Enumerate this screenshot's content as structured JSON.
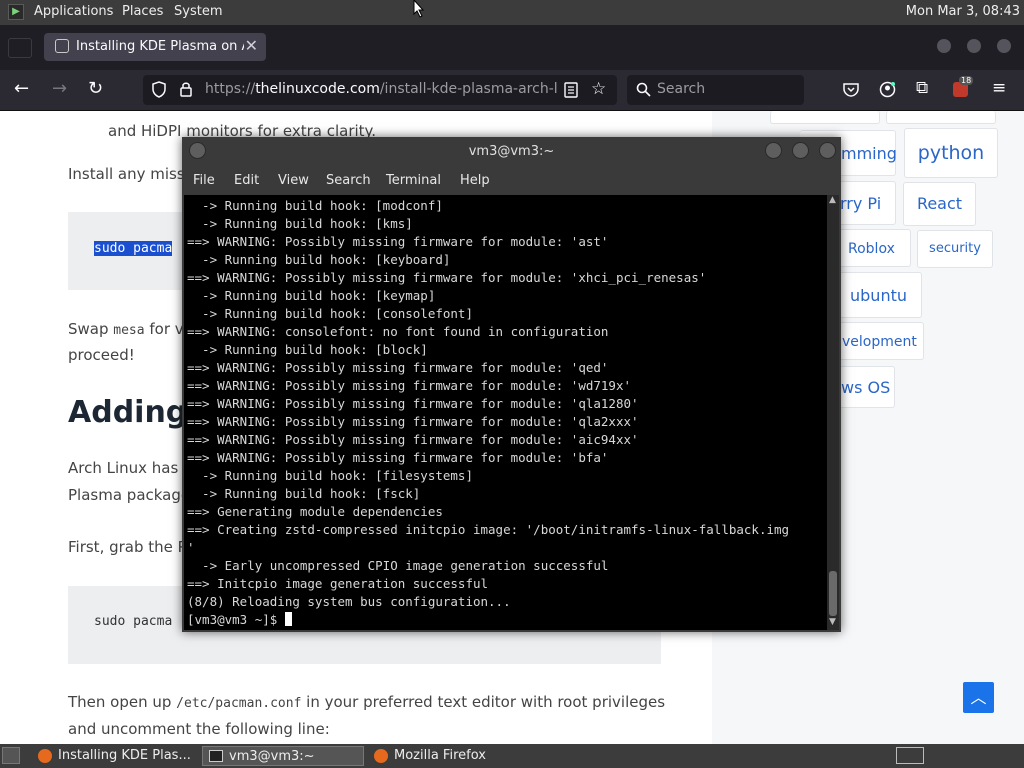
{
  "top_panel": {
    "menus": [
      "Applications",
      "Places",
      "System"
    ],
    "clock": "Mon Mar  3, 08:43"
  },
  "browser": {
    "tab_title": "Installing KDE Plasma on Arch",
    "tab_close": "✕",
    "url_scheme": "https://",
    "url_host": "thelinuxcode.com",
    "url_path": "/install-kde-plasma-arch-linux/",
    "search_placeholder": "Search",
    "addon_badge": "18"
  },
  "article": {
    "line_1": "and HiDPI monitors for extra clarity.",
    "line_2": "Install any missi",
    "code_1": "sudo pacma",
    "swap_prefix": "Swap ",
    "swap_code": "mesa",
    "swap_suffix": " for v",
    "proceed": "proceed!",
    "heading": "Adding",
    "para_1a": "Arch Linux has a",
    "para_1b": "Plasma package",
    "para_2": "First, grab the P",
    "code_2": "sudo pacma",
    "then_prefix": "Then open up ",
    "then_code": "/etc/pacman.conf",
    "then_suffix": " in your preferred text editor with root privileges",
    "uncomment": "and uncomment the following line:"
  },
  "sidebar_tags": [
    "mming",
    "python",
    "rry Pi",
    "React",
    "Roblox",
    "security",
    "ubuntu",
    "velopment",
    "ws OS"
  ],
  "scroll_top_glyph": "︿",
  "terminal": {
    "title": "vm3@vm3:~",
    "menu": [
      "File",
      "Edit",
      "View",
      "Search",
      "Terminal",
      "Help"
    ],
    "lines": [
      "  -> Running build hook: [modconf]",
      "  -> Running build hook: [kms]",
      "==> WARNING: Possibly missing firmware for module: 'ast'",
      "  -> Running build hook: [keyboard]",
      "==> WARNING: Possibly missing firmware for module: 'xhci_pci_renesas'",
      "  -> Running build hook: [keymap]",
      "  -> Running build hook: [consolefont]",
      "==> WARNING: consolefont: no font found in configuration",
      "  -> Running build hook: [block]",
      "==> WARNING: Possibly missing firmware for module: 'qed'",
      "==> WARNING: Possibly missing firmware for module: 'wd719x'",
      "==> WARNING: Possibly missing firmware for module: 'qla1280'",
      "==> WARNING: Possibly missing firmware for module: 'qla2xxx'",
      "==> WARNING: Possibly missing firmware for module: 'aic94xx'",
      "==> WARNING: Possibly missing firmware for module: 'bfa'",
      "  -> Running build hook: [filesystems]",
      "  -> Running build hook: [fsck]",
      "==> Generating module dependencies",
      "==> Creating zstd-compressed initcpio image: '/boot/initramfs-linux-fallback.img",
      "'",
      "  -> Early uncompressed CPIO image generation successful",
      "==> Initcpio image generation successful",
      "(8/8) Reloading system bus configuration..."
    ],
    "prompt": "[vm3@vm3 ~]$ "
  },
  "taskbar": {
    "tasks": [
      "Installing KDE Plas...",
      "vm3@vm3:~",
      "Mozilla Firefox"
    ]
  }
}
